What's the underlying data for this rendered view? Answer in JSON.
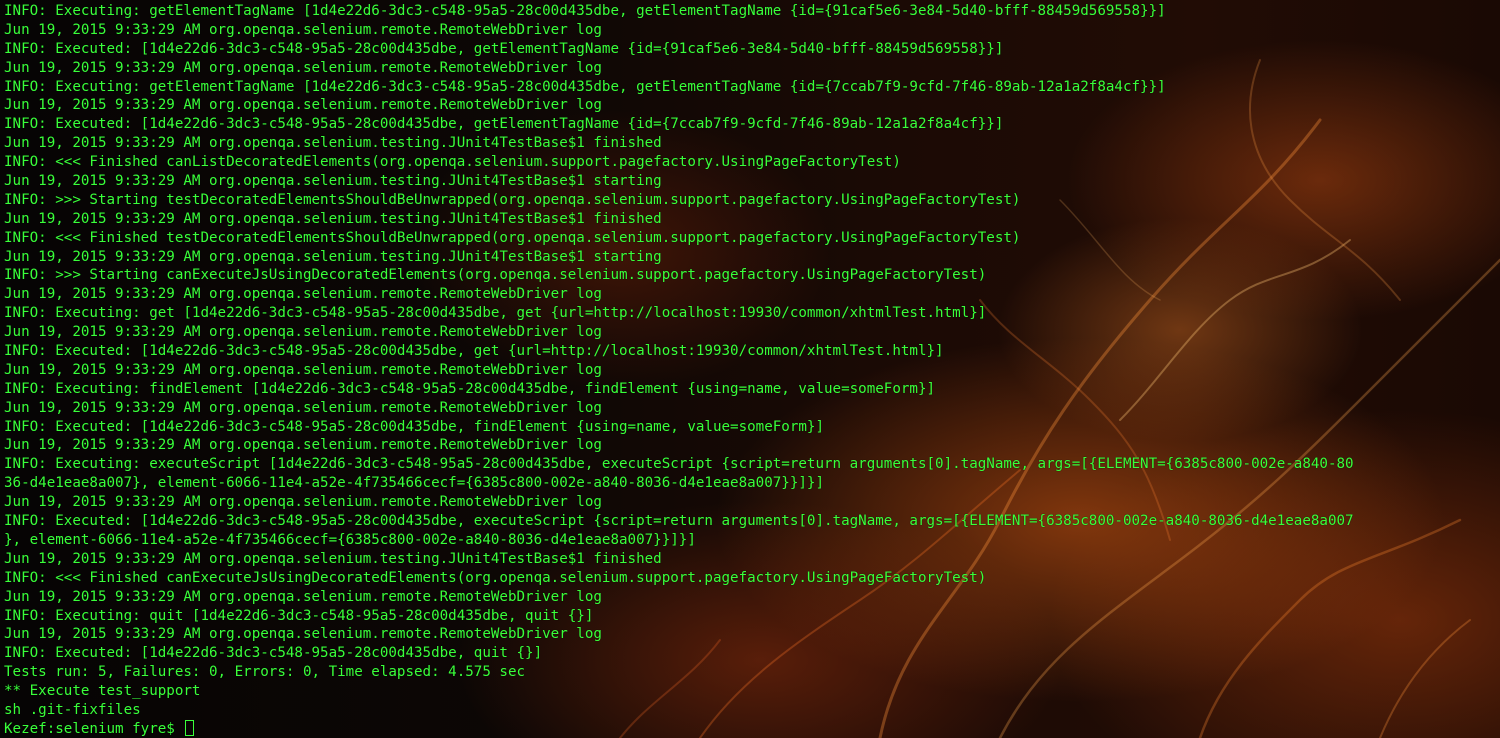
{
  "terminal": {
    "text_color": "#39ff3a",
    "lines": [
      "INFO: Executing: getElementTagName [1d4e22d6-3dc3-c548-95a5-28c00d435dbe, getElementTagName {id={91caf5e6-3e84-5d40-bfff-88459d569558}}]",
      "Jun 19, 2015 9:33:29 AM org.openqa.selenium.remote.RemoteWebDriver log",
      "INFO: Executed: [1d4e22d6-3dc3-c548-95a5-28c00d435dbe, getElementTagName {id={91caf5e6-3e84-5d40-bfff-88459d569558}}]",
      "Jun 19, 2015 9:33:29 AM org.openqa.selenium.remote.RemoteWebDriver log",
      "INFO: Executing: getElementTagName [1d4e22d6-3dc3-c548-95a5-28c00d435dbe, getElementTagName {id={7ccab7f9-9cfd-7f46-89ab-12a1a2f8a4cf}}]",
      "Jun 19, 2015 9:33:29 AM org.openqa.selenium.remote.RemoteWebDriver log",
      "INFO: Executed: [1d4e22d6-3dc3-c548-95a5-28c00d435dbe, getElementTagName {id={7ccab7f9-9cfd-7f46-89ab-12a1a2f8a4cf}}]",
      "Jun 19, 2015 9:33:29 AM org.openqa.selenium.testing.JUnit4TestBase$1 finished",
      "INFO: <<< Finished canListDecoratedElements(org.openqa.selenium.support.pagefactory.UsingPageFactoryTest)",
      "Jun 19, 2015 9:33:29 AM org.openqa.selenium.testing.JUnit4TestBase$1 starting",
      "INFO: >>> Starting testDecoratedElementsShouldBeUnwrapped(org.openqa.selenium.support.pagefactory.UsingPageFactoryTest)",
      "Jun 19, 2015 9:33:29 AM org.openqa.selenium.testing.JUnit4TestBase$1 finished",
      "INFO: <<< Finished testDecoratedElementsShouldBeUnwrapped(org.openqa.selenium.support.pagefactory.UsingPageFactoryTest)",
      "Jun 19, 2015 9:33:29 AM org.openqa.selenium.testing.JUnit4TestBase$1 starting",
      "INFO: >>> Starting canExecuteJsUsingDecoratedElements(org.openqa.selenium.support.pagefactory.UsingPageFactoryTest)",
      "Jun 19, 2015 9:33:29 AM org.openqa.selenium.remote.RemoteWebDriver log",
      "INFO: Executing: get [1d4e22d6-3dc3-c548-95a5-28c00d435dbe, get {url=http://localhost:19930/common/xhtmlTest.html}]",
      "Jun 19, 2015 9:33:29 AM org.openqa.selenium.remote.RemoteWebDriver log",
      "INFO: Executed: [1d4e22d6-3dc3-c548-95a5-28c00d435dbe, get {url=http://localhost:19930/common/xhtmlTest.html}]",
      "Jun 19, 2015 9:33:29 AM org.openqa.selenium.remote.RemoteWebDriver log",
      "INFO: Executing: findElement [1d4e22d6-3dc3-c548-95a5-28c00d435dbe, findElement {using=name, value=someForm}]",
      "Jun 19, 2015 9:33:29 AM org.openqa.selenium.remote.RemoteWebDriver log",
      "INFO: Executed: [1d4e22d6-3dc3-c548-95a5-28c00d435dbe, findElement {using=name, value=someForm}]",
      "Jun 19, 2015 9:33:29 AM org.openqa.selenium.remote.RemoteWebDriver log",
      "INFO: Executing: executeScript [1d4e22d6-3dc3-c548-95a5-28c00d435dbe, executeScript {script=return arguments[0].tagName, args=[{ELEMENT={6385c800-002e-a840-80",
      "36-d4e1eae8a007}, element-6066-11e4-a52e-4f735466cecf={6385c800-002e-a840-8036-d4e1eae8a007}}]}]",
      "Jun 19, 2015 9:33:29 AM org.openqa.selenium.remote.RemoteWebDriver log",
      "INFO: Executed: [1d4e22d6-3dc3-c548-95a5-28c00d435dbe, executeScript {script=return arguments[0].tagName, args=[{ELEMENT={6385c800-002e-a840-8036-d4e1eae8a007",
      "}, element-6066-11e4-a52e-4f735466cecf={6385c800-002e-a840-8036-d4e1eae8a007}}]}]",
      "Jun 19, 2015 9:33:29 AM org.openqa.selenium.testing.JUnit4TestBase$1 finished",
      "INFO: <<< Finished canExecuteJsUsingDecoratedElements(org.openqa.selenium.support.pagefactory.UsingPageFactoryTest)",
      "Jun 19, 2015 9:33:29 AM org.openqa.selenium.remote.RemoteWebDriver log",
      "INFO: Executing: quit [1d4e22d6-3dc3-c548-95a5-28c00d435dbe, quit {}]",
      "Jun 19, 2015 9:33:29 AM org.openqa.selenium.remote.RemoteWebDriver log",
      "INFO: Executed: [1d4e22d6-3dc3-c548-95a5-28c00d435dbe, quit {}]",
      "Tests run: 5, Failures: 0, Errors: 0, Time elapsed: 4.575 sec",
      "** Execute test_support",
      "sh .git-fixfiles"
    ],
    "prompt": "Kezef:selenium fyre$ "
  }
}
